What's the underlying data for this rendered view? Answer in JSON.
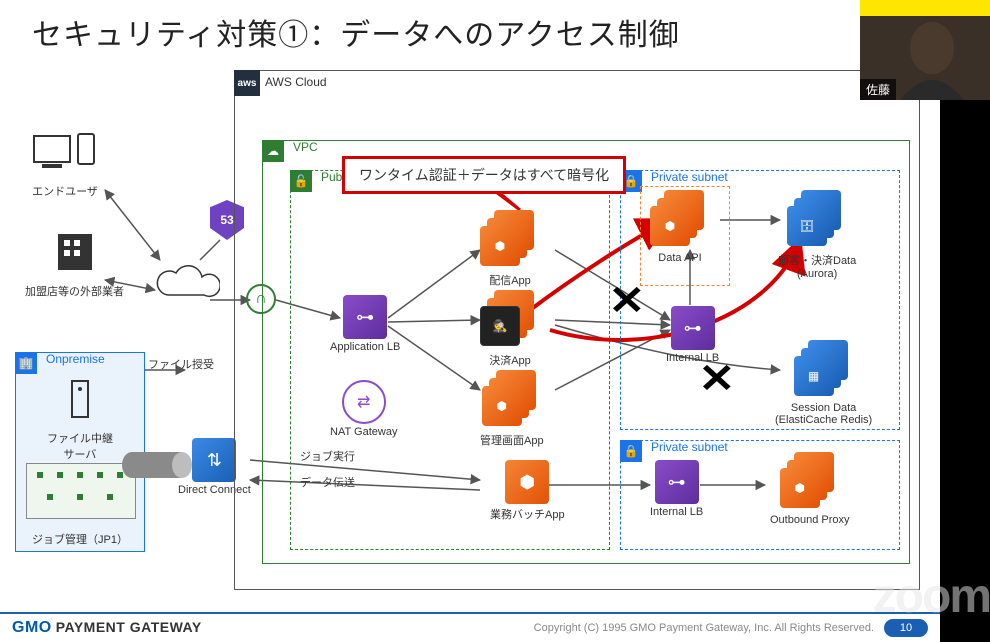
{
  "title": "セキュリティ対策①：データへのアクセス制御",
  "footer": {
    "brand_bold": "GMO",
    "brand_plain": "PAYMENT GATEWAY",
    "copyright": "Copyright (C) 1995 GMO Payment Gateway, Inc. All Rights Reserved.",
    "page": "10"
  },
  "regions": {
    "aws": "AWS Cloud",
    "vpc": "VPC",
    "public": "Public",
    "private1": "Private subnet",
    "private2": "Private subnet",
    "onprem": "Onpremise"
  },
  "labels": {
    "end_user": "エンドユーザ",
    "merchant": "加盟店等の外部業者",
    "file_relay": "ファイル中継\nサーバ",
    "job_mgr": "ジョブ管理（JP1）",
    "file_exchange": "ファイル授受",
    "job_exec": "ジョブ実行",
    "data_transfer": "データ伝送",
    "direct_connect": "Direct Connect",
    "app_lb": "Application LB",
    "nat_gw": "NAT Gateway",
    "dist_app": "配信App",
    "pay_app": "決済App",
    "admin_app": "管理画面App",
    "batch_app": "業務バッチApp",
    "data_api": "Data API",
    "internal_lb1": "Internal LB",
    "internal_lb2": "Internal LB",
    "customer_data": "顧客・決済Data\n(Aurora)",
    "session_data": "Session Data\n(ElastiCache Redis)",
    "outbound_proxy": "Outbound Proxy",
    "route53": "53"
  },
  "callout": "ワンタイム認証＋データはすべて暗号化",
  "webcam_name": "佐藤",
  "watermark": "zoom"
}
